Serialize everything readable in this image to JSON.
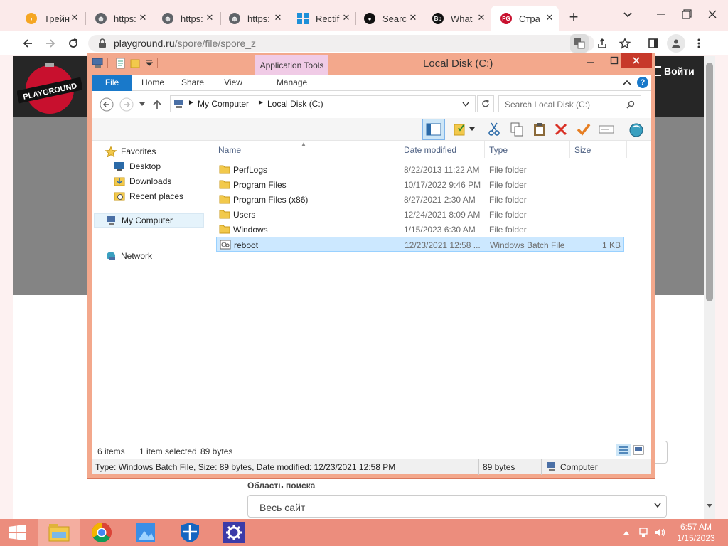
{
  "browser": {
    "tabs": [
      {
        "title": "Трейн",
        "icon": "orange-pacman-icon",
        "color": "#f5a623"
      },
      {
        "title": "https:",
        "icon": "globe-icon",
        "color": "#5f6368"
      },
      {
        "title": "https:",
        "icon": "globe-icon",
        "color": "#5f6368"
      },
      {
        "title": "https:",
        "icon": "globe-icon",
        "color": "#5f6368"
      },
      {
        "title": "Rectif",
        "icon": "windows-logo-icon",
        "color": "#1e90d8"
      },
      {
        "title": "Searc",
        "icon": "github-icon",
        "color": "#111111"
      },
      {
        "title": "What",
        "icon": "bb-icon",
        "color": "#111111"
      },
      {
        "title": "Стра",
        "icon": "pg-icon",
        "color": "#c8102e"
      }
    ],
    "tab_close": "✕",
    "new_tab": "+",
    "url_host": "playground.ru",
    "url_path": "/spore/file/spore_z"
  },
  "site": {
    "login_label": "Войти",
    "logo_text": "PLAYGROUND",
    "search_scope_label": "Область поиска",
    "search_scope_value": "Весь сайт"
  },
  "explorer": {
    "title": "Local Disk (C:)",
    "app_tools": "Application Tools",
    "ribbon_tabs": [
      "File",
      "Home",
      "Share",
      "View",
      "Manage"
    ],
    "path": [
      "My Computer",
      "Local Disk (C:)"
    ],
    "search_placeholder": "Search Local Disk (C:)",
    "nav": {
      "favorites": "Favorites",
      "desktop": "Desktop",
      "downloads": "Downloads",
      "recent": "Recent places",
      "computer": "My Computer",
      "network": "Network"
    },
    "columns": [
      "Name",
      "Date modified",
      "Type",
      "Size"
    ],
    "files": [
      {
        "name": "PerfLogs",
        "date": "8/22/2013 11:22 AM",
        "type": "File folder",
        "size": "",
        "kind": "folder"
      },
      {
        "name": "Program Files",
        "date": "10/17/2022 9:46 PM",
        "type": "File folder",
        "size": "",
        "kind": "folder"
      },
      {
        "name": "Program Files (x86)",
        "date": "8/27/2021 2:30 AM",
        "type": "File folder",
        "size": "",
        "kind": "folder"
      },
      {
        "name": "Users",
        "date": "12/24/2021 8:09 AM",
        "type": "File folder",
        "size": "",
        "kind": "folder"
      },
      {
        "name": "Windows",
        "date": "1/15/2023 6:30 AM",
        "type": "File folder",
        "size": "",
        "kind": "folder"
      },
      {
        "name": "reboot",
        "date": "12/23/2021 12:58 ...",
        "type": "Windows Batch File",
        "size": "1 KB",
        "kind": "batch",
        "selected": true
      }
    ],
    "status": {
      "items": "6 items",
      "selected": "1 item selected",
      "size": "89 bytes"
    },
    "details": {
      "info": "Type: Windows Batch File, Size: 89 bytes, Date modified: 12/23/2021 12:58 PM",
      "size": "89 bytes",
      "location": "Computer"
    }
  },
  "taskbar": {
    "time": "6:57 AM",
    "date": "1/15/2023",
    "items": [
      "start-button",
      "file-explorer",
      "chrome",
      "photos",
      "defender",
      "settings"
    ]
  },
  "colors": {
    "window_frame": "#f3a88c",
    "taskbar": "#ec8d7d",
    "selection": "#cce8ff",
    "file_tab": "#1979ca"
  }
}
